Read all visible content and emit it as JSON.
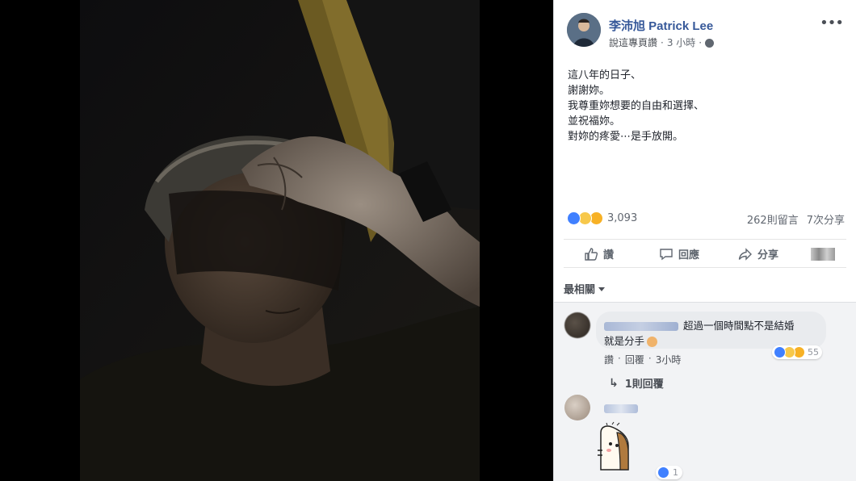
{
  "post": {
    "page_name": "李沛旭 Patrick Lee",
    "follow_label": "說這專頁讚",
    "separator": "·",
    "time": "3 小時",
    "more_label": "•••",
    "text_lines": [
      "這八年的日子、",
      "謝謝妳。",
      "我尊重妳想要的自由和選擇、",
      "並祝福妳。",
      "對妳的疼愛⋯是手放開。"
    ]
  },
  "stats": {
    "reaction_count": "3,093",
    "comments": "262則留言",
    "shares": "7次分享",
    "reactions": [
      "like-icon",
      "sad-icon",
      "wow-icon"
    ]
  },
  "actions": {
    "like": "讚",
    "comment": "回應",
    "share": "分享"
  },
  "sort": {
    "label": "最相關"
  },
  "comments": [
    {
      "line1": "超過一個時間點不是結婚",
      "line2": "就是分手",
      "like_link": "讚",
      "reply_link": "回覆",
      "time": "3小時",
      "reaction_count": "55",
      "replies_label": "1則回覆"
    },
    {
      "reaction_count": "1"
    }
  ],
  "colors": {
    "link_blue": "#365899",
    "like_blue": "#4080ff",
    "panel_bg": "#ffffff",
    "comments_bg": "#f2f3f5"
  }
}
